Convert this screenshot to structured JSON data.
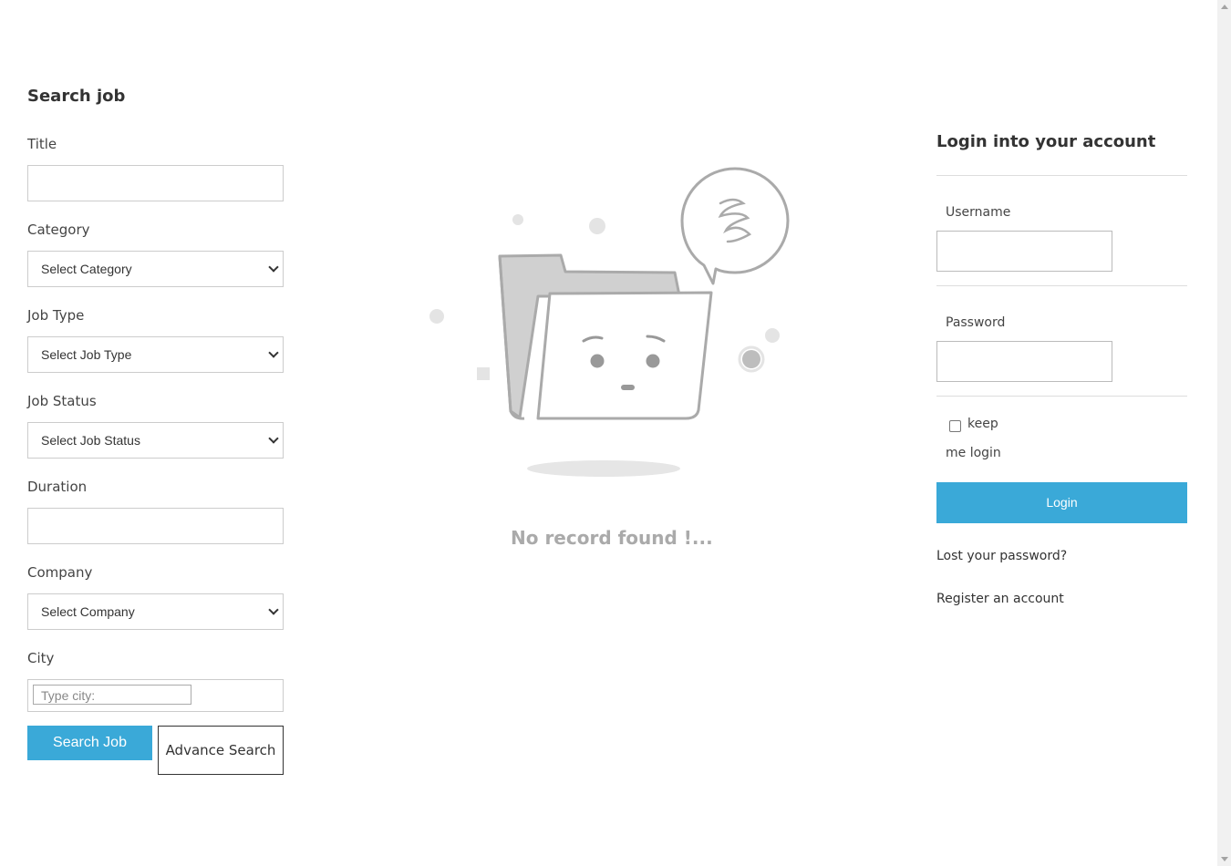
{
  "search": {
    "heading": "Search job",
    "title_label": "Title",
    "title_value": "",
    "category_label": "Category",
    "category_selected": "Select Category",
    "job_type_label": "Job Type",
    "job_type_selected": "Select Job Type",
    "job_status_label": "Job Status",
    "job_status_selected": "Select Job Status",
    "duration_label": "Duration",
    "duration_value": "",
    "company_label": "Company",
    "company_selected": "Select Company",
    "city_label": "City",
    "city_placeholder": "Type city:",
    "search_button": "Search Job",
    "advance_button": "Advance Search"
  },
  "results": {
    "empty_message": "No record found !..."
  },
  "login": {
    "heading": "Login into your account",
    "username_label": "Username",
    "username_value": "",
    "password_label": "Password",
    "password_value": "",
    "keep_label_1": "keep",
    "keep_label_2": "me login",
    "keep_checked": false,
    "login_button": "Login",
    "lost_password_link": "Lost your password?",
    "register_link": "Register an account"
  },
  "colors": {
    "accent": "#3aa9d8",
    "empty_text": "#aaaaaa"
  },
  "icons": {
    "empty_state": "empty-folder-illustration"
  }
}
